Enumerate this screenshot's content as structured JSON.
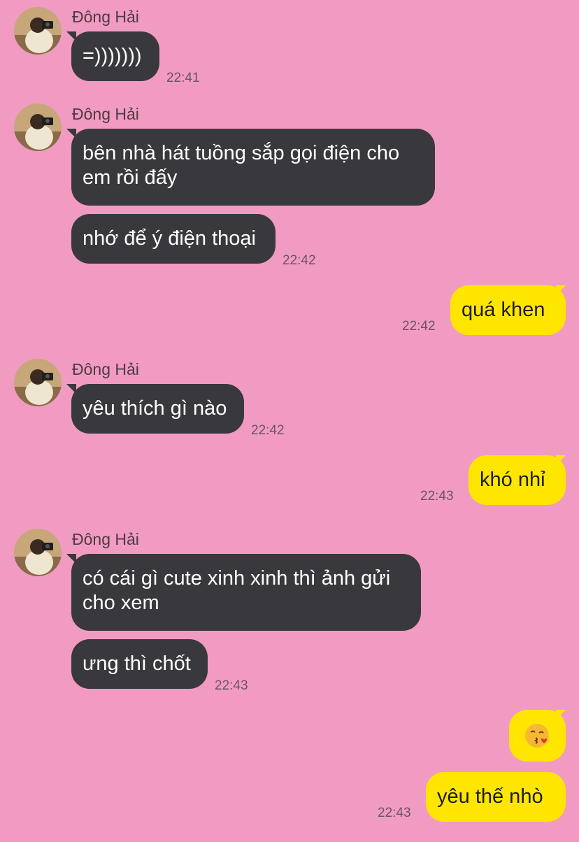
{
  "contact": {
    "name": "Đông Hải",
    "avatar_icon": "profile-photo-icon"
  },
  "colors": {
    "background": "#f29bc2",
    "incoming_bubble": "#39393d",
    "outgoing_bubble": "#ffe600"
  },
  "messages": [
    {
      "direction": "incoming",
      "sender": "Đông Hải",
      "text": "=)))))))",
      "time": "22:41"
    },
    {
      "direction": "incoming",
      "sender": "Đông Hải",
      "text": "bên nhà hát tuồng sắp gọi điện cho em rồi đấy",
      "time": ""
    },
    {
      "direction": "incoming",
      "sender": "",
      "text": "nhớ để ý điện thoại",
      "time": "22:42"
    },
    {
      "direction": "outgoing",
      "text": "quá khen",
      "time": "22:42"
    },
    {
      "direction": "incoming",
      "sender": "Đông Hải",
      "text": "yêu thích gì nào",
      "time": "22:42"
    },
    {
      "direction": "outgoing",
      "text": "khó nhỉ",
      "time": "22:43"
    },
    {
      "direction": "incoming",
      "sender": "Đông Hải",
      "text": "có cái gì cute xinh xinh thì ảnh gửi cho xem",
      "time": ""
    },
    {
      "direction": "incoming",
      "sender": "",
      "text": "ưng thì chốt",
      "time": "22:43"
    },
    {
      "direction": "outgoing",
      "text": "",
      "emoji": "kissing-face-emoji",
      "time": ""
    },
    {
      "direction": "outgoing",
      "text": "yêu thế nhò",
      "time": "22:43"
    }
  ]
}
